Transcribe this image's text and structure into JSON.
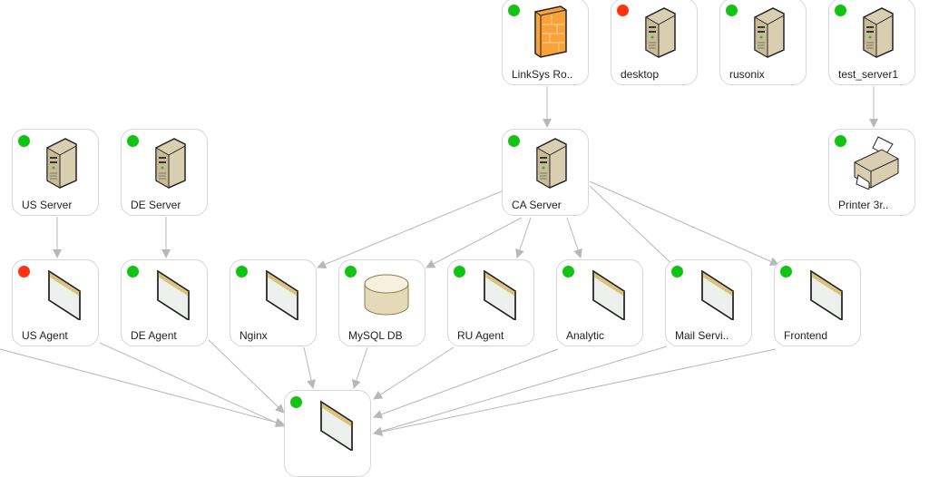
{
  "colors": {
    "ok": "#11c411",
    "error": "#ff3311",
    "edge": "#b8b8b8"
  },
  "nodes": [
    {
      "id": "linksys",
      "label": "LinkSys Ro..",
      "status": "ok",
      "icon": "firewall-icon"
    },
    {
      "id": "desktop",
      "label": "desktop",
      "status": "error",
      "icon": "server-icon"
    },
    {
      "id": "rusonix",
      "label": "rusonix",
      "status": "ok",
      "icon": "server-icon"
    },
    {
      "id": "test_server1",
      "label": "test_server1",
      "status": "ok",
      "icon": "server-icon"
    },
    {
      "id": "us_server",
      "label": "US Server",
      "status": "ok",
      "icon": "server-icon"
    },
    {
      "id": "de_server",
      "label": "DE Server",
      "status": "ok",
      "icon": "server-icon"
    },
    {
      "id": "ca_server",
      "label": "CA Server",
      "status": "ok",
      "icon": "server-icon"
    },
    {
      "id": "printer",
      "label": "Printer 3r..",
      "status": "ok",
      "icon": "printer-icon"
    },
    {
      "id": "us_agent",
      "label": "US Agent",
      "status": "error",
      "icon": "application-window-icon"
    },
    {
      "id": "de_agent",
      "label": "DE Agent",
      "status": "ok",
      "icon": "application-window-icon"
    },
    {
      "id": "nginx",
      "label": "Nginx",
      "status": "ok",
      "icon": "application-window-icon"
    },
    {
      "id": "mysql",
      "label": "MySQL DB",
      "status": "ok",
      "icon": "database-icon"
    },
    {
      "id": "ru_agent",
      "label": "RU Agent",
      "status": "ok",
      "icon": "application-window-icon"
    },
    {
      "id": "analytic",
      "label": "Analytic",
      "status": "ok",
      "icon": "application-window-icon"
    },
    {
      "id": "mail",
      "label": "Mail Servi..",
      "status": "ok",
      "icon": "application-window-icon"
    },
    {
      "id": "frontend",
      "label": "Frontend",
      "status": "ok",
      "icon": "application-window-icon"
    },
    {
      "id": "bottom",
      "label": "",
      "status": "ok",
      "icon": "application-window-icon"
    }
  ]
}
